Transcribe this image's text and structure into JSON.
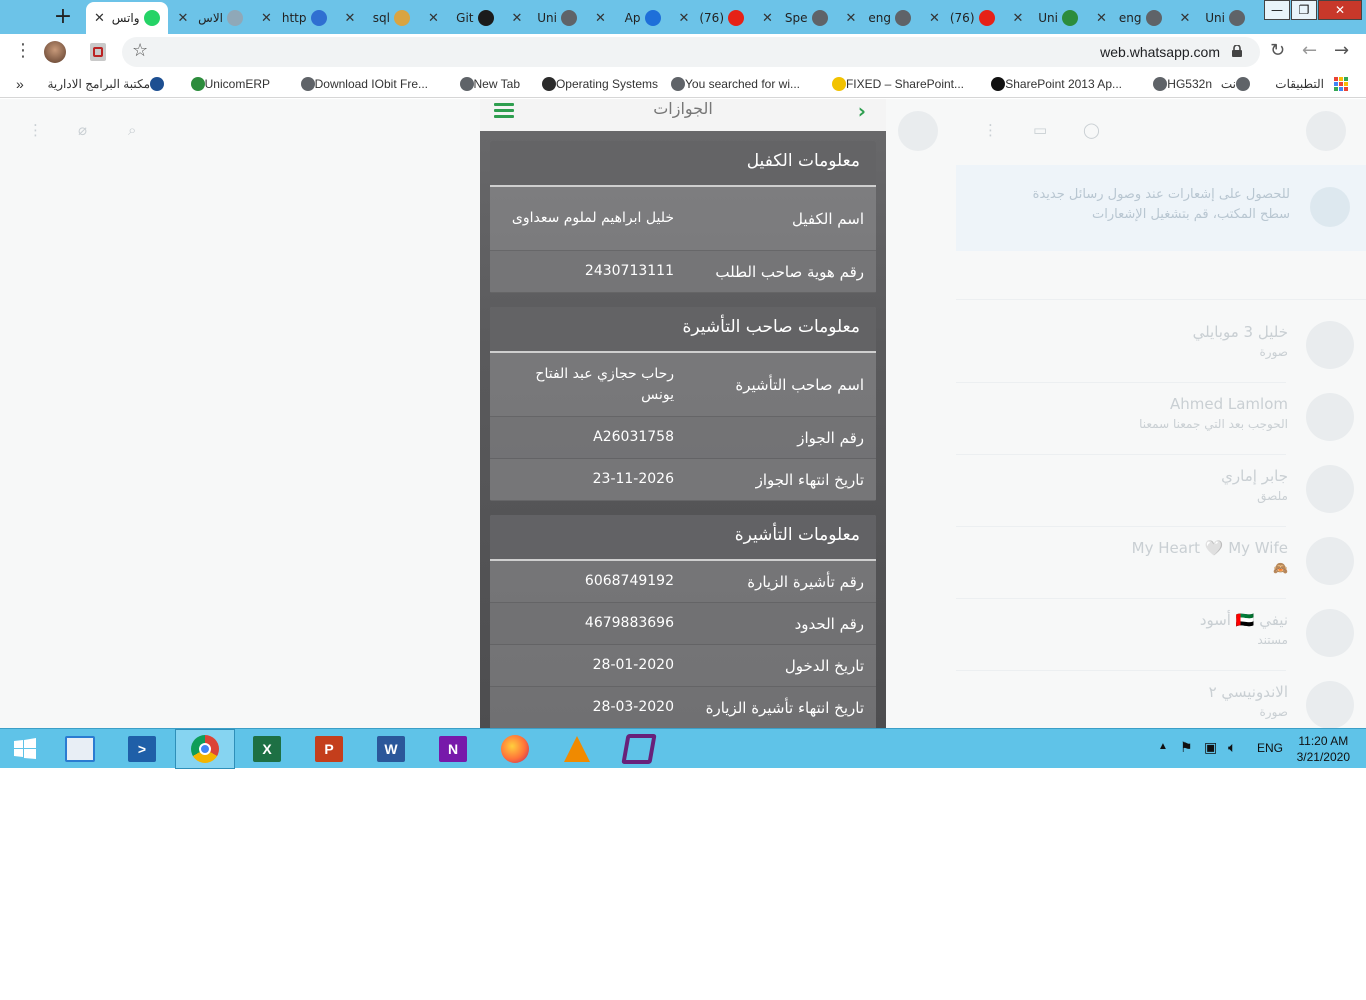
{
  "browser": {
    "tabs": [
      {
        "label": "واتس",
        "favicon_color": "#25d366",
        "active": true
      },
      {
        "label": "الاس",
        "favicon_color": "#8fa8b8",
        "active": false
      },
      {
        "label": "http",
        "favicon_color": "#2f6fd1",
        "active": false
      },
      {
        "label": "sql",
        "favicon_color": "#d9a441",
        "active": false
      },
      {
        "label": "Git",
        "favicon_color": "#1b1b1b",
        "active": false
      },
      {
        "label": "Uni",
        "favicon_color": "#5f6368",
        "active": false
      },
      {
        "label": "Ap",
        "favicon_color": "#1e6fd9",
        "active": false
      },
      {
        "label": "(76)",
        "favicon_color": "#e62117",
        "active": false
      },
      {
        "label": "Spe",
        "favicon_color": "#5f6368",
        "active": false
      },
      {
        "label": "eng",
        "favicon_color": "#5f6368",
        "active": false
      },
      {
        "label": "(76)",
        "favicon_color": "#e62117",
        "active": false
      },
      {
        "label": "Uni",
        "favicon_color": "#2c8c3c",
        "active": false
      },
      {
        "label": "eng",
        "favicon_color": "#5f6368",
        "active": false
      },
      {
        "label": "Uni",
        "favicon_color": "#5f6368",
        "active": false
      }
    ],
    "new_tab_label": "+",
    "url": "web.whatsapp.com",
    "window_controls": {
      "minimize": "—",
      "maximize": "❐",
      "close": "✕"
    }
  },
  "bookmarks": {
    "apps_label": "التطبيقات",
    "items": [
      {
        "label": "نت",
        "rtl": true
      },
      {
        "label": "HG532n",
        "rtl": false
      },
      {
        "label": "SharePoint 2013 Ap...",
        "rtl": false
      },
      {
        "label": "FIXED – SharePoint...",
        "rtl": false
      },
      {
        "label": "You searched for wi...",
        "rtl": false
      },
      {
        "label": "Operating Systems",
        "rtl": false
      },
      {
        "label": "New Tab",
        "rtl": false
      },
      {
        "label": "Download IObit Fre...",
        "rtl": false
      },
      {
        "label": "UnicomERP",
        "rtl": false
      },
      {
        "label": "مكتبة البرامج الادارية",
        "rtl": true
      }
    ],
    "overflow": "»"
  },
  "background": {
    "banner_text": "للحصول على إشعارات عند وصول رسائل جديدة",
    "banner_sub": "سطح المكتب، قم بتشغيل الإشعارات",
    "chats": [
      {
        "name": "خليل 3 موبايلي",
        "sub": "صورة"
      },
      {
        "name": "Ahmed Lamlom",
        "sub": "الحوجب بعد التي جمعنا سمعنا"
      },
      {
        "name": "جابر إماري",
        "sub": "ملصق"
      },
      {
        "name": "My Heart 🤍 My Wife",
        "sub": "🙈"
      },
      {
        "name": "نيفي 🇦🇪 أسود",
        "sub": "مستند"
      },
      {
        "name": "الاندونيسي ٢",
        "sub": "صورة"
      }
    ]
  },
  "phone": {
    "title": "الجوازات",
    "sponsor": {
      "heading": "معلومات الكفيل",
      "rows": [
        {
          "label": "اسم الكفيل",
          "value": "خليل ابراهيم لملوم سعداوى"
        },
        {
          "label": "رقم هوية صاحب الطلب",
          "value": "2430713111"
        }
      ]
    },
    "holder": {
      "heading": "معلومات صاحب التأشيرة",
      "rows": [
        {
          "label": "اسم صاحب التأشيرة",
          "value": "رحاب حجازي عبد الفتاح يونس"
        },
        {
          "label": "رقم الجواز",
          "value": "A26031758"
        },
        {
          "label": "تاريخ انتهاء الجواز",
          "value": "23-11-2026"
        }
      ]
    },
    "visa": {
      "heading": "معلومات التأشيرة",
      "rows": [
        {
          "label": "رقم تأشيرة الزيارة",
          "value": "6068749192"
        },
        {
          "label": "رقم الحدود",
          "value": "4679883696"
        },
        {
          "label": "تاريخ الدخول",
          "value": "28-01-2020"
        },
        {
          "label": "تاريخ انتهاء تأشيرة الزيارة",
          "value": "28-03-2020"
        }
      ]
    }
  },
  "taskbar": {
    "apps": [
      {
        "name": "start",
        "letter": "",
        "color": "#ffffff"
      },
      {
        "name": "file-explorer",
        "letter": "",
        "color": "#2a7bd1"
      },
      {
        "name": "powershell",
        "letter": ">",
        "color": "#1f5fa8"
      },
      {
        "name": "chrome",
        "letter": "",
        "color": "#db4437"
      },
      {
        "name": "excel",
        "letter": "X",
        "color": "#1d7044"
      },
      {
        "name": "powerpoint",
        "letter": "P",
        "color": "#c43e1c"
      },
      {
        "name": "word",
        "letter": "W",
        "color": "#2b579a"
      },
      {
        "name": "onenote",
        "letter": "N",
        "color": "#7719aa"
      },
      {
        "name": "firefox",
        "letter": "",
        "color": "#ff7139"
      },
      {
        "name": "vlc",
        "letter": "",
        "color": "#f08a00"
      },
      {
        "name": "visual-studio",
        "letter": "",
        "color": "#68217a"
      }
    ],
    "language": "ENG",
    "time": "11:20 AM",
    "date": "3/21/2020"
  }
}
